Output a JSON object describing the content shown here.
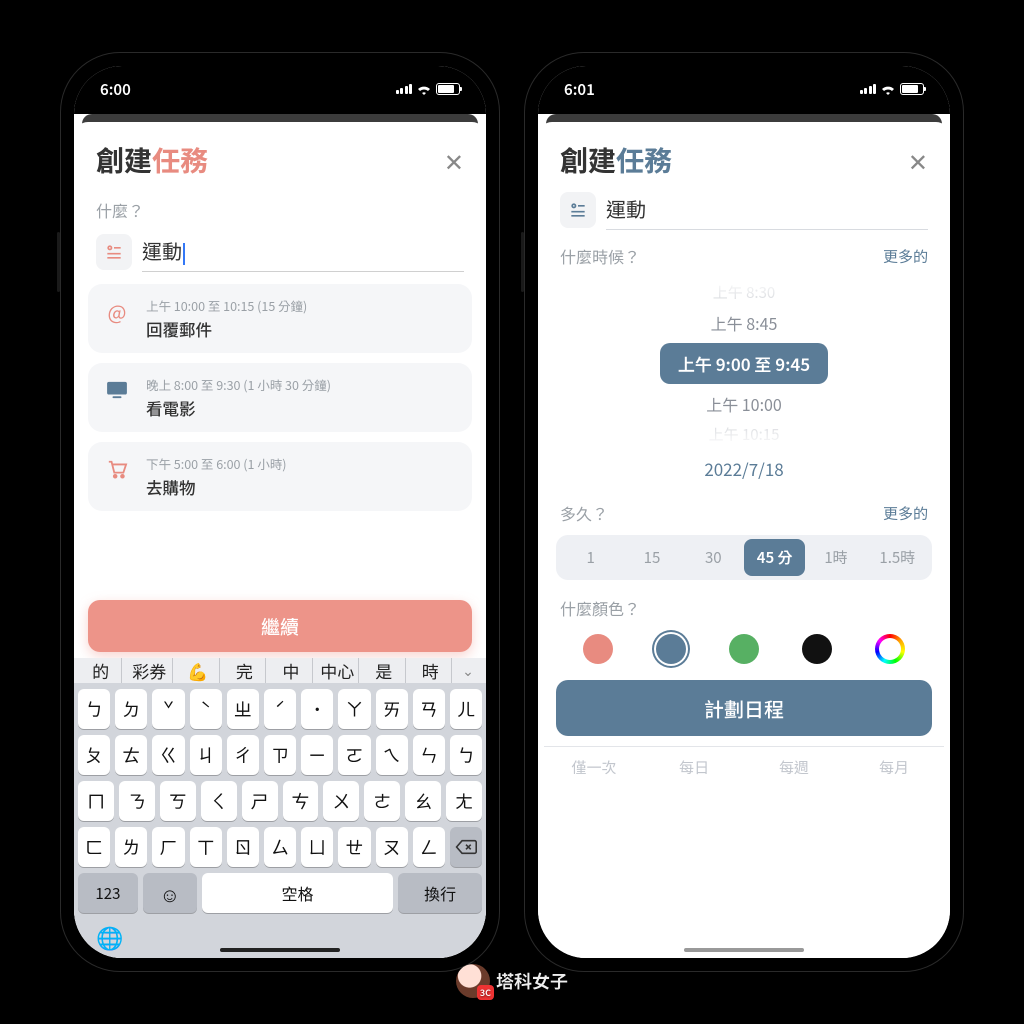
{
  "watermark_text": "塔科女子",
  "left": {
    "time": "6:00",
    "title_a": "創建",
    "title_b": "任務",
    "q_what": "什麼？",
    "task_value": "運動",
    "suggestions": [
      {
        "icon": "@",
        "icon_color": "#E88B80",
        "meta": "上午 10:00 至 10:15 (15 分鐘)",
        "title": "回覆郵件"
      },
      {
        "icon": "tv",
        "icon_color": "#5B7C97",
        "meta": "晚上 8:00 至 9:30 (1 小時 30 分鐘)",
        "title": "看電影"
      },
      {
        "icon": "cart",
        "icon_color": "#E88B80",
        "meta": "下午 5:00 至 6:00 (1 小時)",
        "title": "去購物"
      }
    ],
    "continue": "繼續",
    "kb_suggestions": [
      "的",
      "彩券",
      "💪",
      "完",
      "中",
      "中心",
      "是",
      "時"
    ],
    "kb_rows": [
      [
        "ㄅ",
        "ㄉ",
        "ˇ",
        "ˋ",
        "ㄓ",
        "ˊ",
        "˙",
        "ㄚ",
        "ㄞ",
        "ㄢ",
        "ㄦ"
      ],
      [
        "ㄆ",
        "ㄊ",
        "ㄍ",
        "ㄐ",
        "ㄔ",
        "ㄗ",
        "ㄧ",
        "ㄛ",
        "ㄟ",
        "ㄣ",
        "ㄅ"
      ],
      [
        "ㄇ",
        "ㄋ",
        "ㄎ",
        "ㄑ",
        "ㄕ",
        "ㄘ",
        "ㄨ",
        "ㄜ",
        "ㄠ",
        "ㄤ"
      ],
      [
        "ㄈ",
        "ㄌ",
        "ㄏ",
        "ㄒ",
        "ㄖ",
        "ㄙ",
        "ㄩ",
        "ㄝ",
        "ㄡ",
        "ㄥ"
      ]
    ],
    "kb_123": "123",
    "kb_space": "空格",
    "kb_return": "換行"
  },
  "right": {
    "time": "6:01",
    "title_a": "創建",
    "title_b": "任務",
    "task_value": "運動",
    "q_when": "什麼時候？",
    "more": "更多的",
    "times": {
      "above2": "上午 8:30",
      "above1": "上午 8:45",
      "selected": "上午 9:00 至 9:45",
      "below1": "上午 10:00",
      "below2": "上午 10:15"
    },
    "date": "2022/7/18",
    "q_howlong": "多久？",
    "durations": [
      "1",
      "15",
      "30",
      "45 分",
      "1時",
      "1.5時"
    ],
    "duration_selected_index": 3,
    "q_color": "什麼顏色？",
    "colors": [
      "#E88B80",
      "#5B7C97",
      "#57B063",
      "#111111",
      "rainbow"
    ],
    "color_selected_index": 1,
    "schedule": "計劃日程",
    "repeat": [
      "僅一次",
      "每日",
      "每週",
      "每月"
    ]
  }
}
